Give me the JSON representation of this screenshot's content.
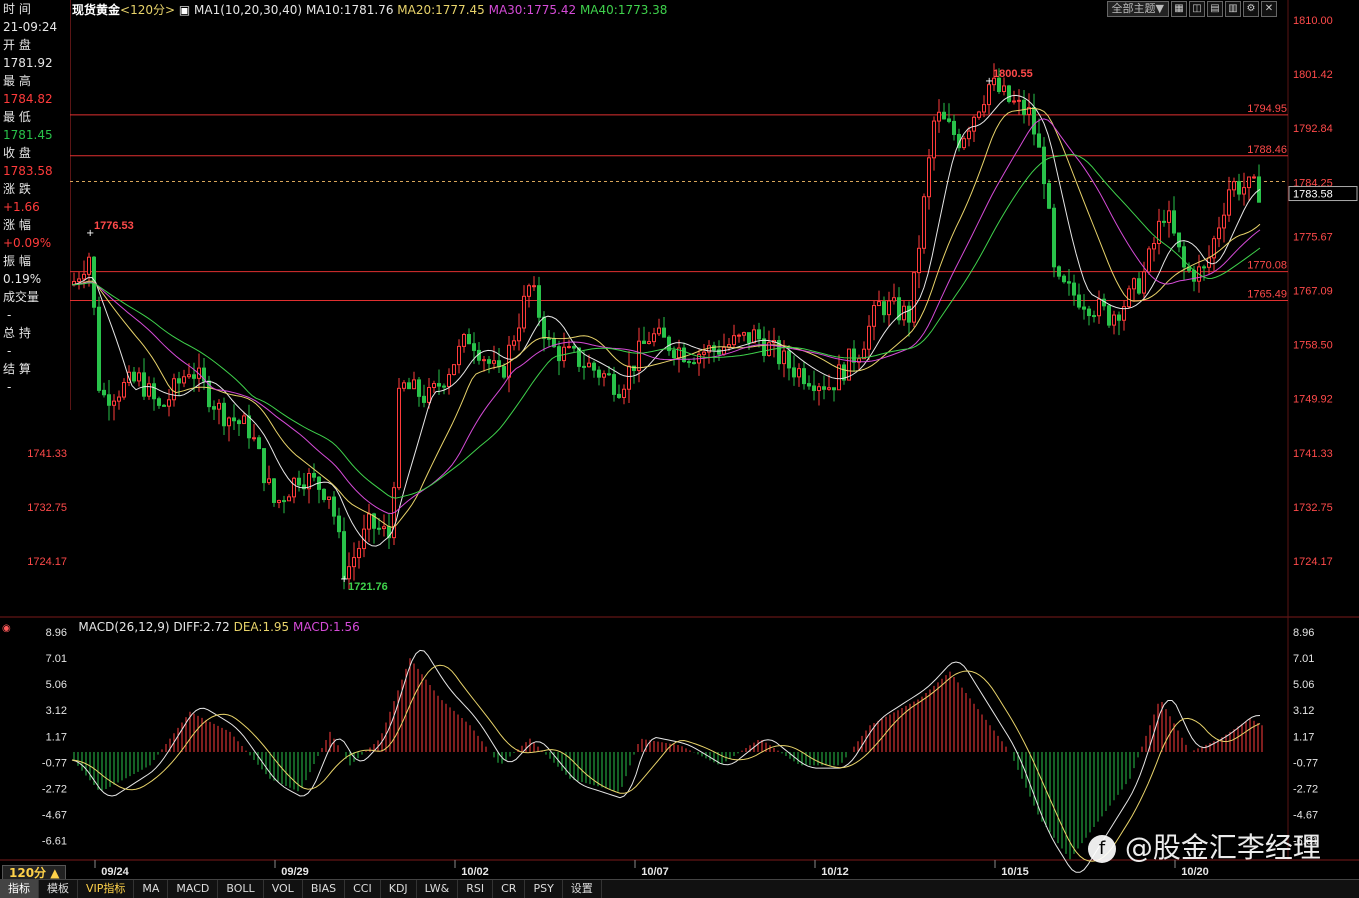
{
  "header": {
    "title": "现货黄金",
    "period": "<120分>",
    "ma_label": "MA1(10,20,30,40)",
    "ma10": "MA10:1781.76",
    "ma20": "MA20:1777.45",
    "ma30": "MA30:1775.42",
    "ma40": "MA40:1773.38",
    "theme_button": "全部主题▼"
  },
  "info_panel": {
    "time_label": "时 间",
    "time_value": "21-09:24",
    "open_label": "开 盘",
    "open_value": "1781.92",
    "high_label": "最 高",
    "high_value": "1784.82",
    "low_label": "最 低",
    "low_value": "1781.45",
    "close_label": "收 盘",
    "close_value": "1783.58",
    "change_label": "涨 跌",
    "change_value": "+1.66",
    "pct_label": "涨 幅",
    "pct_value": "+0.09%",
    "amp_label": "振 幅",
    "amp_value": "0.19%",
    "vol_label": "成交量",
    "vol_value": "-",
    "hold_label": "总 持",
    "hold_value": "-",
    "settle_label": "结 算",
    "settle_value": "-"
  },
  "price_axis": [
    "1810.00",
    "1801.42",
    "1792.84",
    "1784.25",
    "1775.67",
    "1767.09",
    "1758.50",
    "1749.92",
    "1741.33",
    "1732.75",
    "1724.17"
  ],
  "left_axis": [
    "1741.33",
    "1732.75",
    "1724.17"
  ],
  "current_price": "1783.58",
  "levels": [
    {
      "label": "1794.95",
      "value": 1794.95
    },
    {
      "label": "1788.46",
      "value": 1788.46
    },
    {
      "label": "1770.08",
      "value": 1770.08
    },
    {
      "label": "1765.49",
      "value": 1765.49
    }
  ],
  "annotations": {
    "high_left": "1776.53",
    "low": "1721.76",
    "high_peak": "1800.55"
  },
  "macd": {
    "label": "MACD(26,12,9)",
    "diff": "DIFF:2.72",
    "dea": "DEA:1.95",
    "macd": "MACD:1.56",
    "axis": [
      "8.96",
      "7.01",
      "5.06",
      "3.12",
      "1.17",
      "-0.77",
      "-2.72",
      "-4.67",
      "-6.61"
    ]
  },
  "date_axis": [
    "09/24",
    "09/29",
    "10/02",
    "10/07",
    "10/12",
    "10/15",
    "10/20"
  ],
  "period_selector": "120分 ▲",
  "watermark": "@股金汇李经理",
  "tabs": [
    "指标",
    "模板",
    "VIP指标",
    "MA",
    "MACD",
    "BOLL",
    "VOL",
    "BIAS",
    "CCI",
    "KDJ",
    "LW&",
    "RSI",
    "CR",
    "PSY",
    "设置"
  ],
  "colors": {
    "up": "#ff3b3b",
    "down": "#29c24a",
    "ma10": "#e6e6e6",
    "ma20": "#e8d36a",
    "ma30": "#d54bd7",
    "ma40": "#3fd24c"
  }
}
